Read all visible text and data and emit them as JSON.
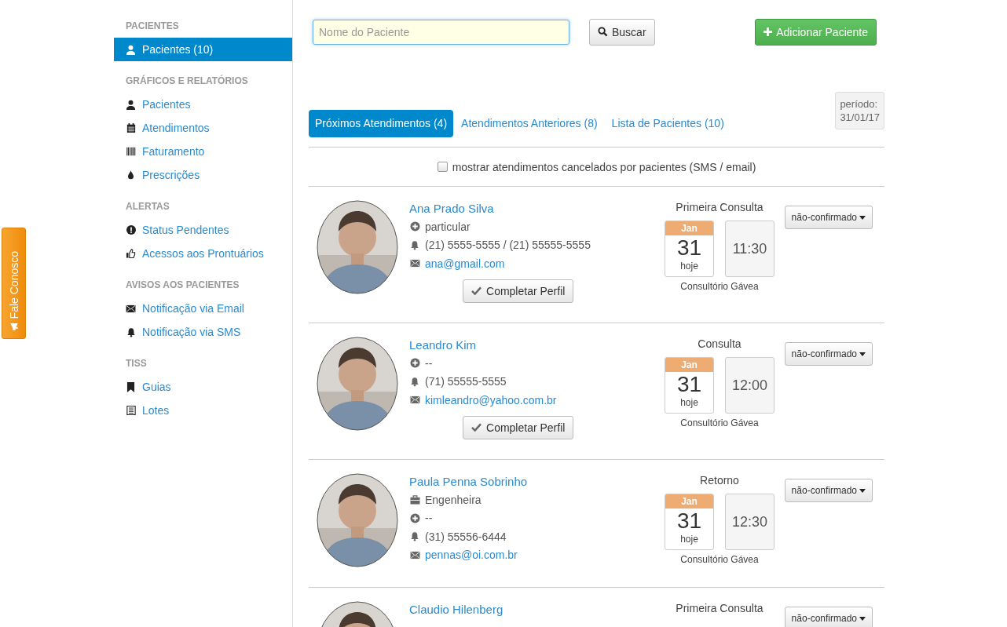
{
  "feedback_tab": {
    "label": "Fale Conosco"
  },
  "sidebar": {
    "sections": [
      {
        "title": "PACIENTES",
        "items": [
          {
            "label": "Pacientes (10)",
            "kind": "user",
            "selected": true
          }
        ]
      },
      {
        "title": "GRÁFICOS E RELATÓRIOS",
        "items": [
          {
            "label": "Pacientes",
            "kind": "user",
            "selected": false
          },
          {
            "label": "Atendimentos",
            "kind": "calendar",
            "selected": false
          },
          {
            "label": "Faturamento",
            "kind": "barcode",
            "selected": false
          },
          {
            "label": "Prescrições",
            "kind": "drop",
            "selected": false
          }
        ]
      },
      {
        "title": "ALERTAS",
        "items": [
          {
            "label": "Status Pendentes",
            "kind": "alert",
            "selected": false
          },
          {
            "label": "Acessos aos Prontuários",
            "kind": "thumb",
            "selected": false
          }
        ]
      },
      {
        "title": "AVISOS AOS PACIENTES",
        "items": [
          {
            "label": "Notificação via Email",
            "kind": "envelope",
            "selected": false
          },
          {
            "label": "Notificação via SMS",
            "kind": "bell",
            "selected": false
          }
        ]
      },
      {
        "title": "TISS",
        "items": [
          {
            "label": "Guias",
            "kind": "bookmark",
            "selected": false
          },
          {
            "label": "Lotes",
            "kind": "list",
            "selected": false
          }
        ]
      }
    ]
  },
  "search": {
    "placeholder": "Nome do Paciente",
    "button": "Buscar"
  },
  "add_button": "Adicionar Paciente",
  "tabs": [
    {
      "label": "Próximos Atendimentos (4)",
      "selected": true
    },
    {
      "label": "Atendimentos Anteriores (8)",
      "selected": false
    },
    {
      "label": "Lista de Pacientes (10)",
      "selected": false
    }
  ],
  "period": {
    "label": "período:",
    "value": "31/01/17"
  },
  "filter": {
    "label": "mostrar atendimentos cancelados por pacientes (SMS / email)",
    "checked": false
  },
  "appointments": [
    {
      "name": "Ana Prado Silva",
      "photo": {
        "kind": "picture"
      },
      "details": [
        {
          "kind": "insurance",
          "text": "particular"
        },
        {
          "kind": "phone",
          "text": "(21) 5555-5555 / (21) 55555-5555"
        },
        {
          "kind": "email",
          "text": "ana@gmail.com"
        }
      ],
      "action": "Completar Perfil",
      "type": "Primeira Consulta",
      "month": "Jan",
      "day": "31",
      "relative": "hoje",
      "time": "11:30",
      "location": "Consultório Gávea",
      "status": "não-confirmado"
    },
    {
      "name": "Leandro Kim",
      "photo": {
        "kind": "picture"
      },
      "details": [
        {
          "kind": "insurance",
          "text": "--"
        },
        {
          "kind": "phone",
          "text": "(71) 55555-5555"
        },
        {
          "kind": "email",
          "text": "kimleandro@yahoo.com.br"
        }
      ],
      "action": "Completar Perfil",
      "type": "Consulta",
      "month": "Jan",
      "day": "31",
      "relative": "hoje",
      "time": "12:00",
      "location": "Consultório Gávea",
      "status": "não-confirmado"
    },
    {
      "name": "Paula Penna Sobrinho",
      "photo": {
        "kind": "picture"
      },
      "details": [
        {
          "kind": "job",
          "text": "Engenheira"
        },
        {
          "kind": "insurance",
          "text": "--"
        },
        {
          "kind": "phone",
          "text": "(31) 55556-6444"
        },
        {
          "kind": "email",
          "text": "pennas@oi.com.br"
        }
      ],
      "type": "Retorno",
      "month": "Jan",
      "day": "31",
      "relative": "hoje",
      "time": "12:30",
      "location": "Consultório Gávea",
      "status": "não-confirmado"
    },
    {
      "name": "Claudio Hilenberg",
      "photo": {
        "kind": "picture"
      },
      "type": "Primeira Consulta",
      "status": "não-confirmado"
    }
  ]
}
